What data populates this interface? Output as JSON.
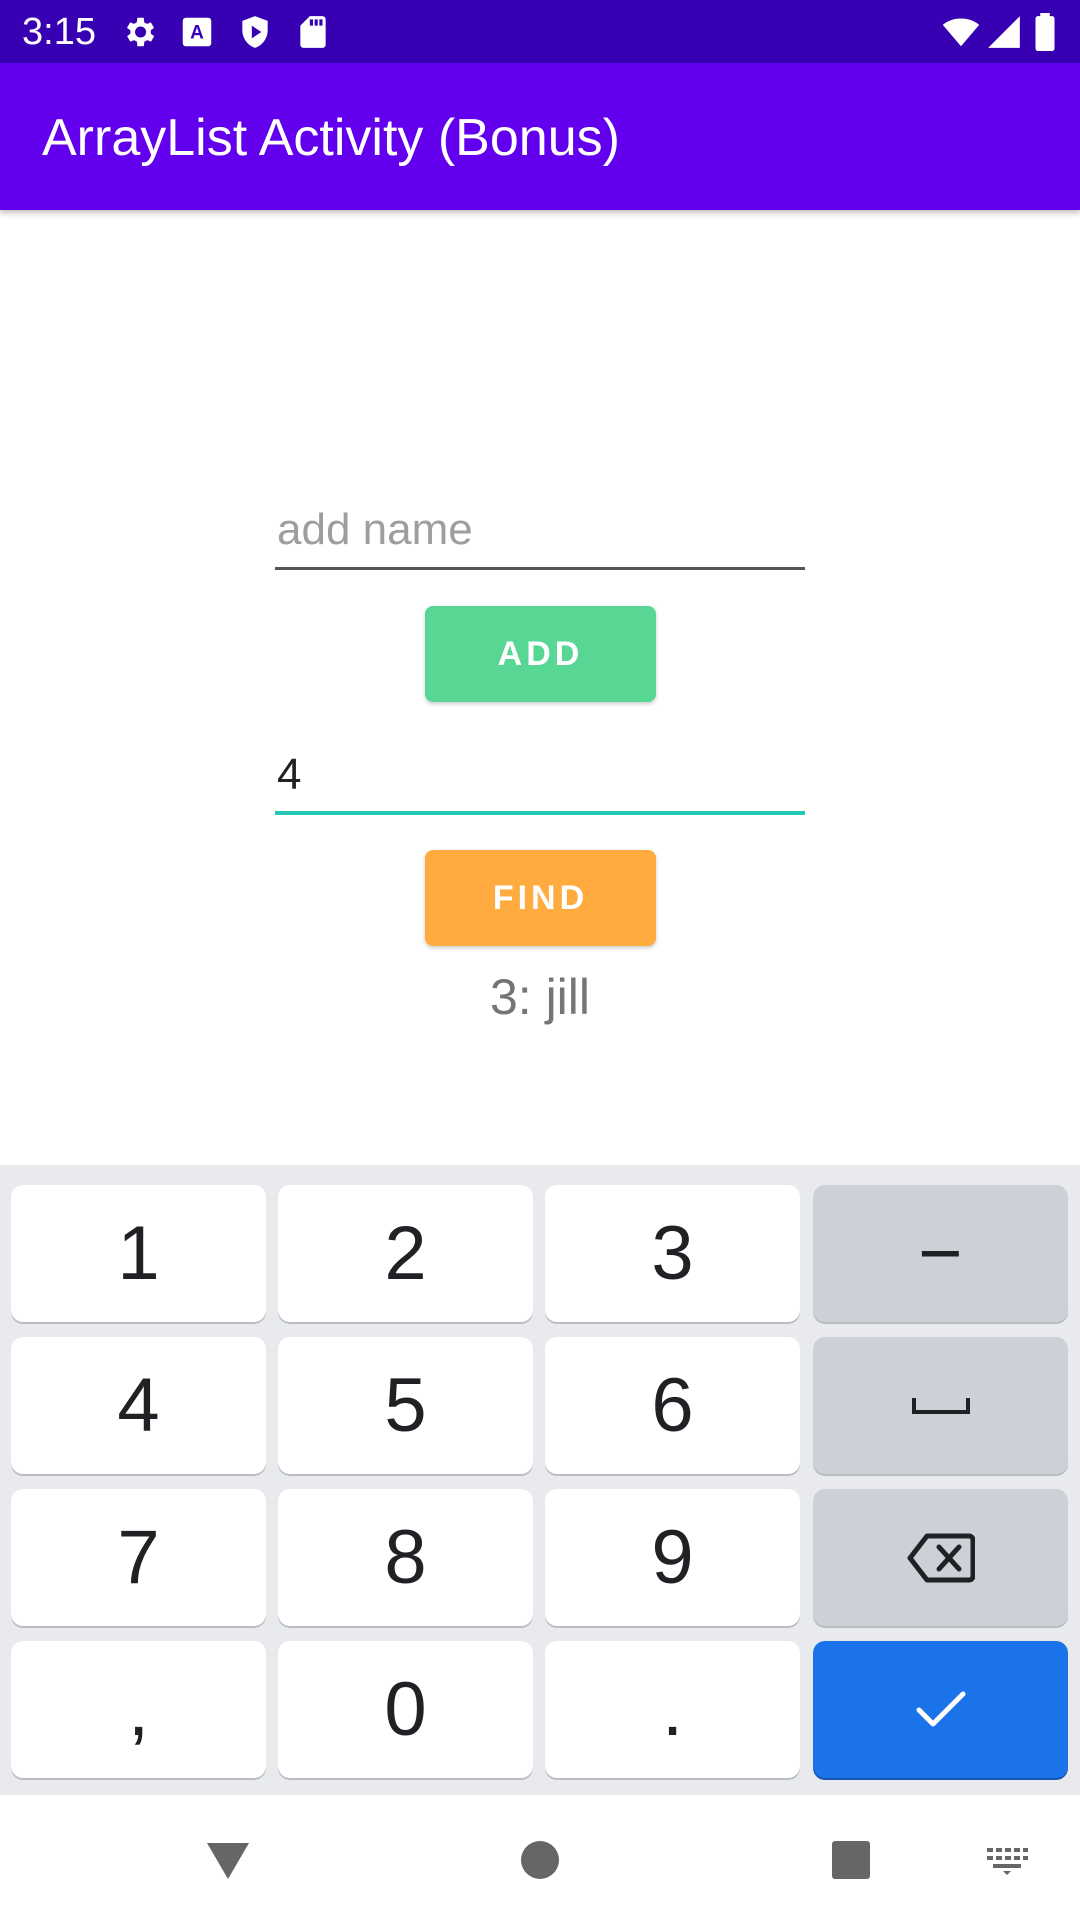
{
  "status_bar": {
    "time": "3:15",
    "icons": [
      "settings-icon",
      "text-a-icon",
      "shield-play-icon",
      "sd-card-icon",
      "wifi-icon",
      "signal-icon",
      "battery-icon"
    ]
  },
  "app_bar": {
    "title": "ArrayList Activity (Bonus)",
    "color": "#6200ee",
    "status_color": "#3700b3"
  },
  "form": {
    "name_placeholder": "add name",
    "name_value": "",
    "add_label": "ADD",
    "add_color": "#57d694",
    "index_value": "4",
    "find_label": "FIND",
    "find_color": "#ffab40",
    "result": "3: jill"
  },
  "keyboard": {
    "rows": [
      [
        "1",
        "2",
        "3",
        "−"
      ],
      [
        "4",
        "5",
        "6",
        "space-icon"
      ],
      [
        "7",
        "8",
        "9",
        "backspace-icon"
      ],
      [
        ",",
        "0",
        ".",
        "check-icon"
      ]
    ],
    "action_color": "#1a73e8"
  },
  "nav_bar": {
    "icons": [
      "back-icon",
      "home-icon",
      "recents-icon",
      "keyboard-icon"
    ]
  }
}
